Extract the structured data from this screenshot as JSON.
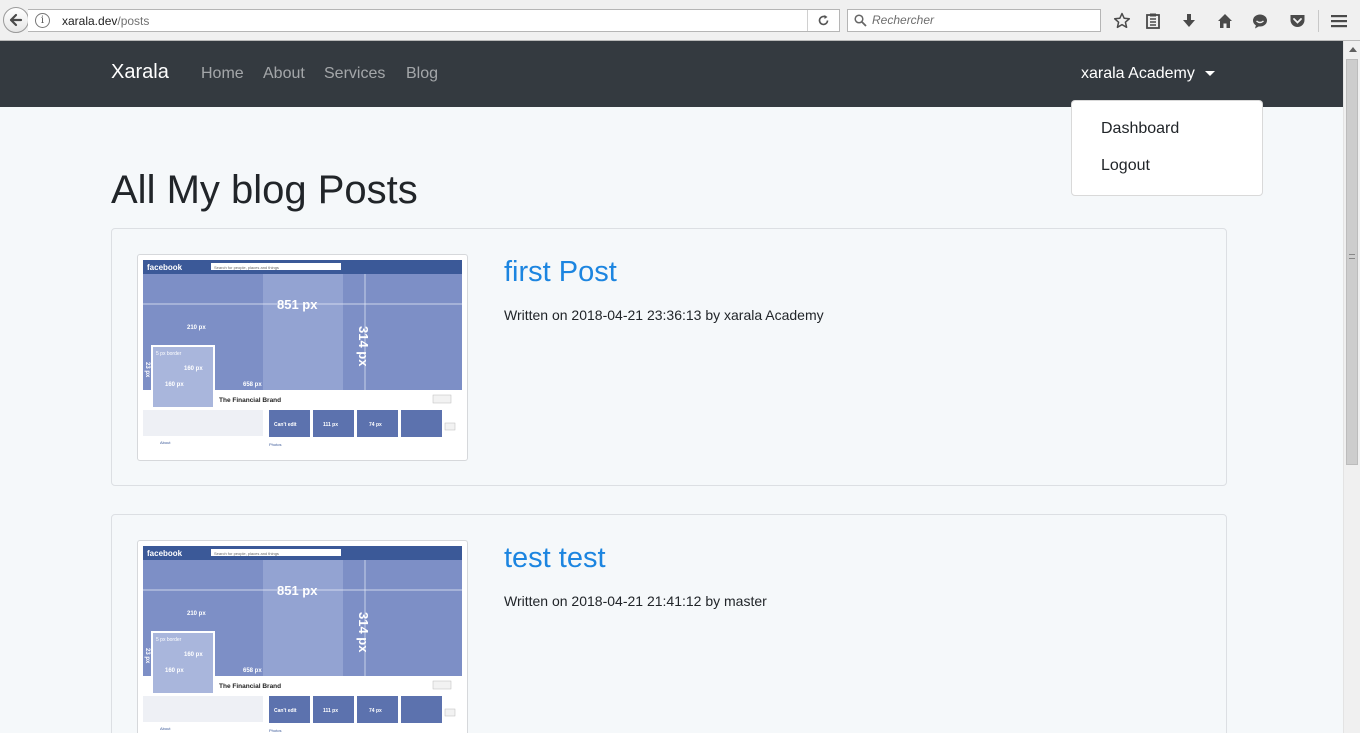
{
  "browser": {
    "url_domain": "xarala.dev",
    "url_path": "/posts",
    "search_placeholder": "Rechercher",
    "toolbar_icons": [
      "star-icon",
      "reading-list-icon",
      "download-icon",
      "home-icon",
      "chat-icon",
      "pocket-icon",
      "menu-icon"
    ]
  },
  "navbar": {
    "brand": "Xarala",
    "links": [
      "Home",
      "About",
      "Services",
      "Blog"
    ],
    "user": "xarala Academy",
    "dropdown": [
      "Dashboard",
      "Logout"
    ]
  },
  "page": {
    "title": "All My blog Posts"
  },
  "posts": [
    {
      "title": "first Post",
      "meta": "Written on 2018-04-21 23:36:13 by xarala Academy"
    },
    {
      "title": "test test",
      "meta": "Written on 2018-04-21 21:41:12 by master"
    }
  ],
  "cover_image": {
    "site": "facebook",
    "search": "Search for people, places and things",
    "width_label": "851 px",
    "height_label": "314 px",
    "offset_label": "210 px",
    "border_label": "5 px border",
    "profile_label": "160 px",
    "profile_width_label": "160 px",
    "left_label": "23 px",
    "bottom_label": "658 px",
    "page_name": "The Financial Brand",
    "tile1": "Can't edit",
    "tile2": "111 px",
    "tile3": "74 px",
    "tab_about": "About",
    "tab_photos": "Photos"
  },
  "colors": {
    "navbar": "#343a40",
    "link": "#1c85e0",
    "background": "#f5f8fa"
  }
}
